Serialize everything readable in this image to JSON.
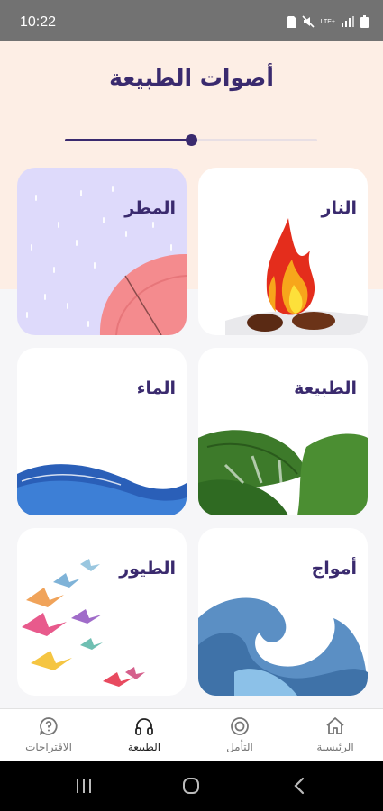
{
  "status_bar": {
    "time": "10:22",
    "network_label": "LTE+"
  },
  "page": {
    "title": "أصوات الطبيعة"
  },
  "progress": {
    "value": 0.5
  },
  "cards": [
    {
      "key": "fire",
      "label": "النار"
    },
    {
      "key": "rain",
      "label": "المطر"
    },
    {
      "key": "nature",
      "label": "الطبيعة"
    },
    {
      "key": "water",
      "label": "الماء"
    },
    {
      "key": "waves",
      "label": "أمواج"
    },
    {
      "key": "birds",
      "label": "الطيور"
    }
  ],
  "bottom_nav": [
    {
      "label": "الرئيسية",
      "icon": "home-icon",
      "active": false
    },
    {
      "label": "التأمل",
      "icon": "meditation-icon",
      "active": false
    },
    {
      "label": "الطبيعة",
      "icon": "headphones-icon",
      "active": true
    },
    {
      "label": "الاقتراحات",
      "icon": "question-icon",
      "active": false
    }
  ],
  "colors": {
    "title": "#3a2a6e",
    "peach": "#fdeee5",
    "card": "#ffffff",
    "nav_active": "#222222"
  }
}
